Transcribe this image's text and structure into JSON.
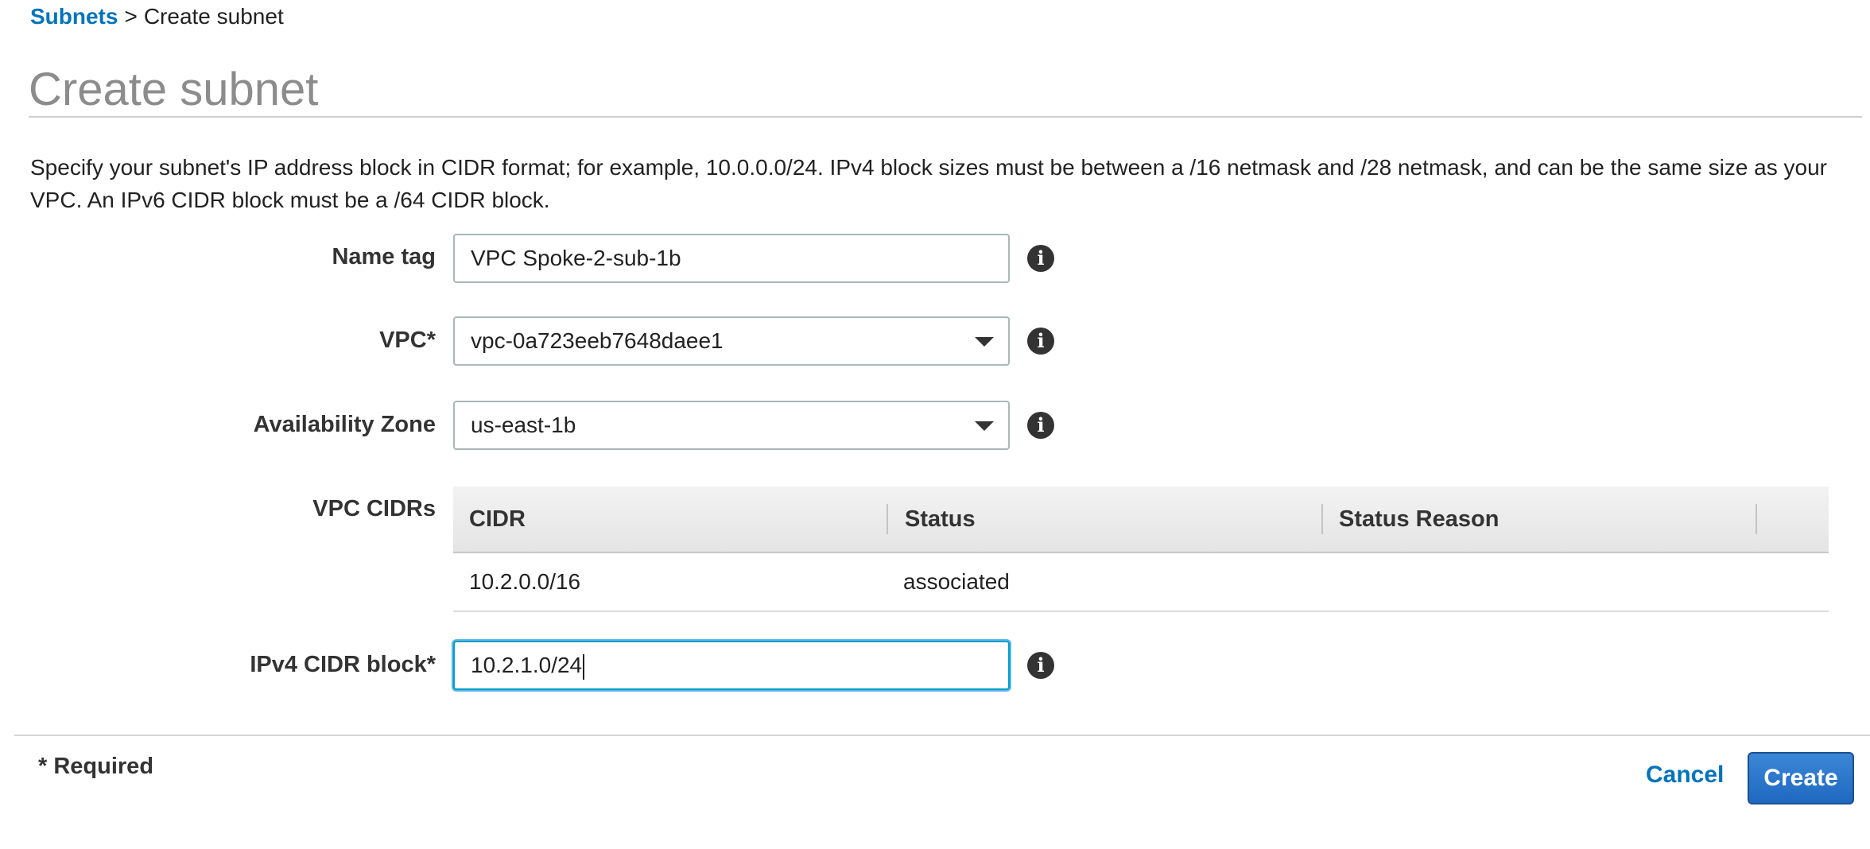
{
  "breadcrumb": {
    "link_label": "Subnets",
    "separator": ">",
    "current": "Create subnet"
  },
  "page": {
    "title": "Create subnet",
    "description": "Specify your subnet's IP address block in CIDR format; for example, 10.0.0.0/24. IPv4 block sizes must be between a /16 netmask and /28 netmask, and can be the same size as your VPC. An IPv6 CIDR block must be a /64 CIDR block."
  },
  "form": {
    "name_tag": {
      "label": "Name tag",
      "value": "VPC Spoke-2-sub-1b"
    },
    "vpc": {
      "label": "VPC*",
      "value": "vpc-0a723eeb7648daee1"
    },
    "availability_zone": {
      "label": "Availability Zone",
      "value": "us-east-1b"
    },
    "vpc_cidrs": {
      "label": "VPC CIDRs",
      "columns": [
        "CIDR",
        "Status",
        "Status Reason"
      ],
      "rows": [
        {
          "cidr": "10.2.0.0/16",
          "status": "associated",
          "status_reason": ""
        }
      ]
    },
    "ipv4_cidr_block": {
      "label": "IPv4 CIDR block*",
      "value": "10.2.1.0/24"
    }
  },
  "footer": {
    "required_note": "* Required",
    "cancel_label": "Cancel",
    "create_label": "Create"
  },
  "icons": {
    "info": "info-icon",
    "dropdown": "chevron-down-icon"
  },
  "colors": {
    "link": "#0073bb",
    "status_ok": "#1d8102",
    "primary_button": "#1f68c0",
    "focus_ring": "#00a1c9"
  }
}
